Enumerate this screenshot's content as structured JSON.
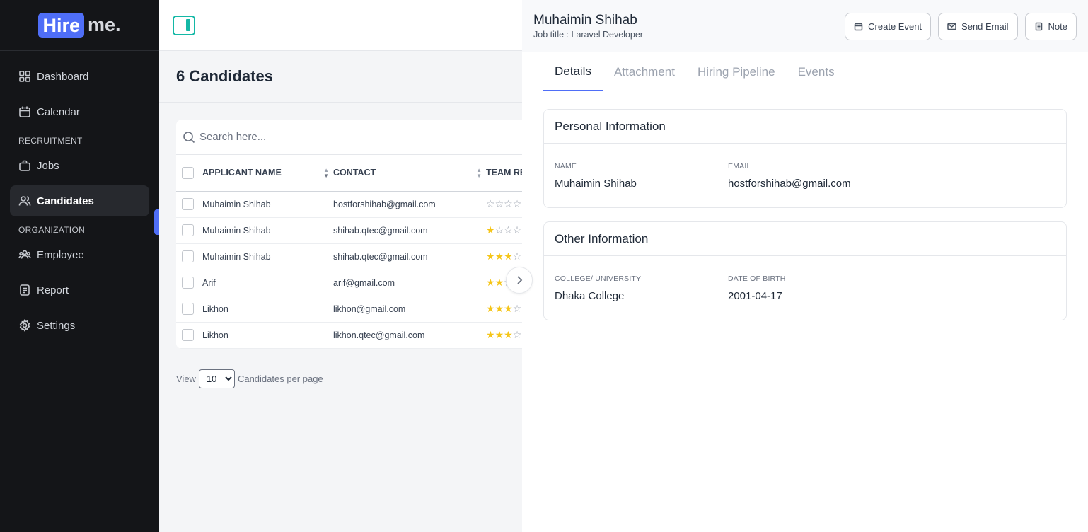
{
  "brand": {
    "part1": "Hire",
    "part2": "me."
  },
  "sidebar": {
    "items": [
      {
        "label": "Dashboard",
        "icon": "grid-icon"
      },
      {
        "label": "Calendar",
        "icon": "calendar-icon"
      }
    ],
    "section1": "RECRUITMENT",
    "items2": [
      {
        "label": "Jobs",
        "icon": "briefcase-icon"
      },
      {
        "label": "Candidates",
        "icon": "users-icon"
      }
    ],
    "section2": "ORGANIZATION",
    "items3": [
      {
        "label": "Employee",
        "icon": "team-icon"
      },
      {
        "label": "Report",
        "icon": "document-icon"
      },
      {
        "label": "Settings",
        "icon": "gear-icon"
      }
    ]
  },
  "main": {
    "title": "6 Candidates",
    "search_placeholder": "Search here...",
    "columns": [
      "APPLICANT NAME",
      "CONTACT",
      "TEAM RE"
    ],
    "rows": [
      {
        "name": "Muhaimin Shihab",
        "contact": "hostforshihab@gmail.com",
        "rating": 0
      },
      {
        "name": "Muhaimin Shihab",
        "contact": "shihab.qtec@gmail.com",
        "rating": 1
      },
      {
        "name": "Muhaimin Shihab",
        "contact": "shihab.qtec@gmail.com",
        "rating": 3
      },
      {
        "name": "Arif",
        "contact": "arif@gmail.com",
        "rating": 2
      },
      {
        "name": "Likhon",
        "contact": "likhon@gmail.com",
        "rating": 3
      },
      {
        "name": "Likhon",
        "contact": "likhon.qtec@gmail.com",
        "rating": 3
      }
    ],
    "per_page": {
      "prefix": "View",
      "value": "10",
      "options": [
        "10"
      ],
      "suffix": "Candidates per page"
    }
  },
  "drawer": {
    "name": "Muhaimin Shihab",
    "job": "Job title : Laravel Developer",
    "actions": {
      "create_event": "Create Event",
      "send_email": "Send Email",
      "note": "Note"
    },
    "tabs": [
      "Details",
      "Attachment",
      "Hiring Pipeline",
      "Events"
    ],
    "personal": {
      "title": "Personal Information",
      "name_label": "NAME",
      "name_value": "Muhaimin Shihab",
      "email_label": "EMAIL",
      "email_value": "hostforshihab@gmail.com"
    },
    "other": {
      "title": "Other Information",
      "college_label": "COLLEGE/ UNIVERSITY",
      "college_value": "Dhaka College",
      "dob_label": "DATE OF BIRTH",
      "dob_value": "2001-04-17"
    }
  },
  "colors": {
    "accent": "#4f6ef7",
    "teal": "#14b8a6",
    "star": "#f5c518",
    "sidebar_bg": "#141518"
  }
}
